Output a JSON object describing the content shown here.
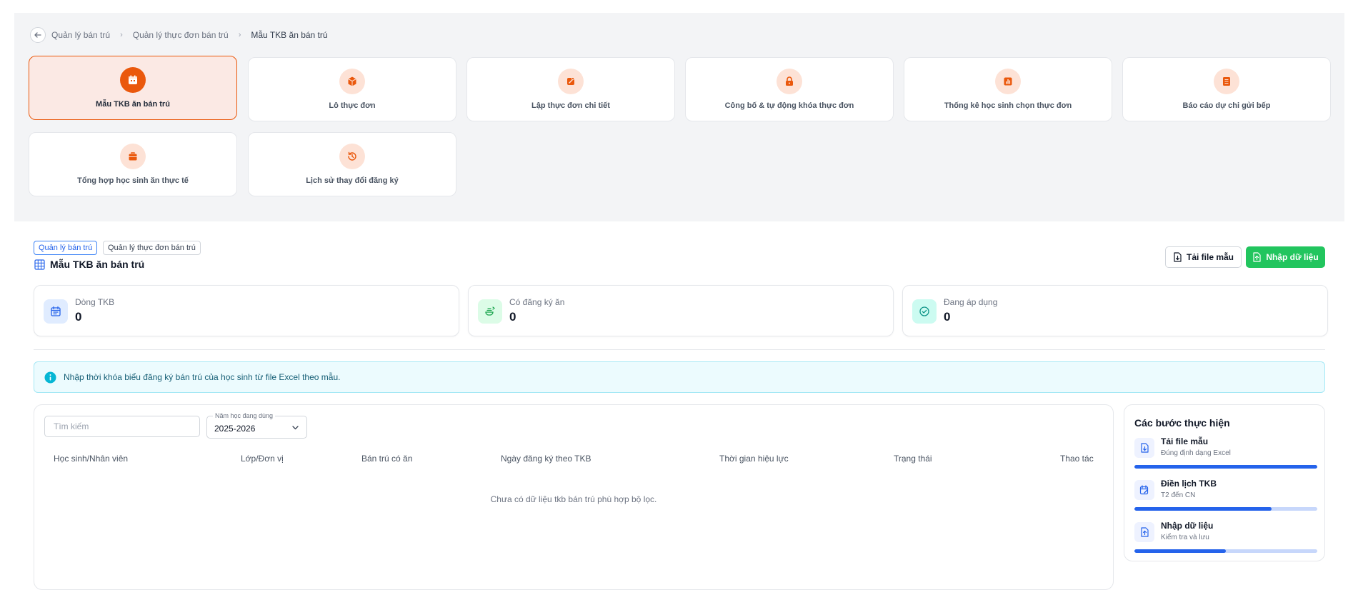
{
  "breadcrumb": {
    "items": [
      {
        "label": "Quản lý bán trú"
      },
      {
        "label": "Quản lý thực đơn bán trú"
      },
      {
        "label": "Mẫu TKB ăn bán trú"
      }
    ]
  },
  "modules": [
    {
      "label": "Mẫu TKB ăn bán trú",
      "icon": "calendar-icon",
      "active": true
    },
    {
      "label": "Lô thực đơn",
      "icon": "box-icon"
    },
    {
      "label": "Lập thực đơn chi tiết",
      "icon": "note-edit-icon"
    },
    {
      "label": "Công bố & tự động khóa thực đơn",
      "icon": "lock-icon"
    },
    {
      "label": "Thống kê học sinh chọn thực đơn",
      "icon": "bar-chart-icon"
    },
    {
      "label": "Báo cáo dự chi gửi bếp",
      "icon": "report-list-icon"
    },
    {
      "label": "Tổng hợp học sinh ăn thực tế",
      "icon": "briefcase-icon"
    },
    {
      "label": "Lịch sử thay đổi đăng ký",
      "icon": "history-icon"
    }
  ],
  "tags": [
    "Quản lý bán trú",
    "Quản lý thực đơn bán trú"
  ],
  "page_title": "Mẫu TKB ăn bán trú",
  "actions": {
    "download_label": "Tải file mẫu",
    "import_label": "Nhập dữ liệu"
  },
  "stats": [
    {
      "label": "Dòng TKB",
      "value": "0",
      "icon": "calendar-icon",
      "color": "#2563eb",
      "bg": "#e0ecff"
    },
    {
      "label": "Có đăng ký ăn",
      "value": "0",
      "icon": "meal-icon",
      "color": "#16a34a",
      "bg": "#dcfce7"
    },
    {
      "label": "Đang áp dụng",
      "value": "0",
      "icon": "check-circle-icon",
      "color": "#0d9488",
      "bg": "#ccfbf1"
    }
  ],
  "info_message": "Nhập thời khóa biểu đăng ký bán trú của học sinh từ file Excel theo mẫu.",
  "filters": {
    "search_placeholder": "Tìm kiếm",
    "year_label": "Năm học đang dùng",
    "year_value": "2025-2026"
  },
  "table": {
    "columns": [
      "Học sinh/Nhân viên",
      "Lớp/Đơn vị",
      "Bán trú có ăn",
      "Ngày đăng ký theo TKB",
      "Thời gian hiệu lực",
      "Trạng thái",
      "Thao tác"
    ],
    "empty_message": "Chưa có dữ liệu tkb bán trú phù hợp bộ lọc."
  },
  "steps": {
    "title": "Các bước thực hiện",
    "items": [
      {
        "name": "Tải file mẫu",
        "desc": "Đúng định dạng Excel",
        "progress": 1.0
      },
      {
        "name": "Điền lịch TKB",
        "desc": "T2 đến CN",
        "progress": 0.75
      },
      {
        "name": "Nhập dữ liệu",
        "desc": "Kiểm tra và lưu",
        "progress": 0.5
      }
    ]
  },
  "colors": {
    "accent_orange": "#ea580c",
    "primary_blue": "#2563eb",
    "success_green": "#22c55e"
  }
}
